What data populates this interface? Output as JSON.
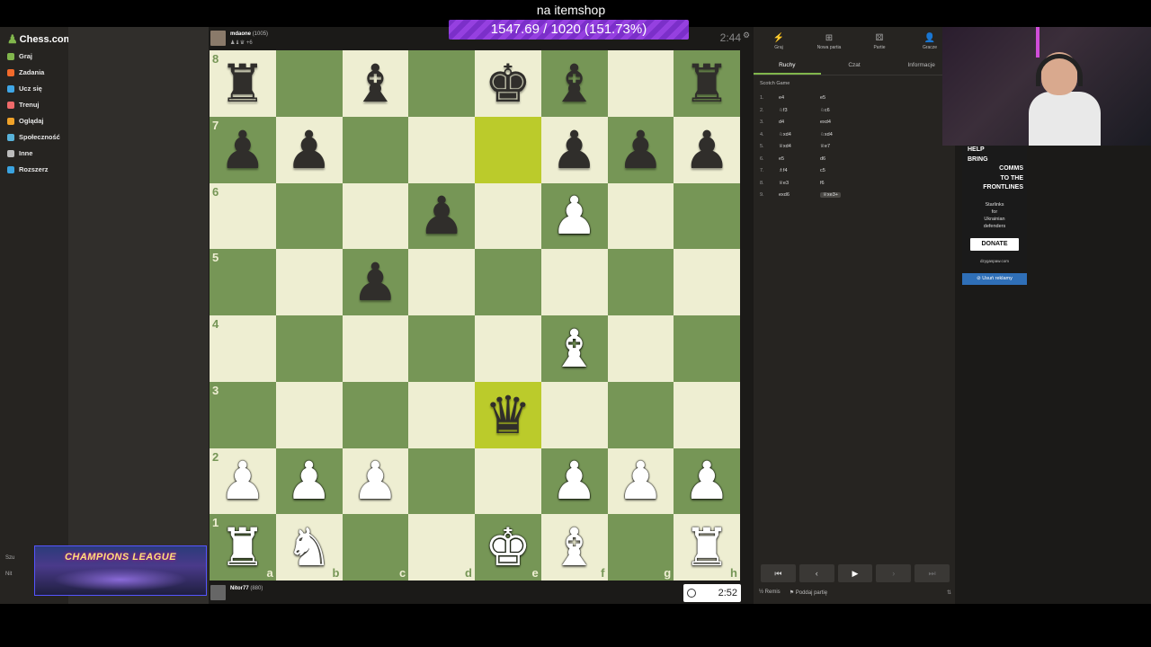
{
  "stream": {
    "itemshop_text": "na itemshop",
    "goal_text": "1547.69 / 1020 (151.73%)"
  },
  "logo": {
    "text": "Chess.com"
  },
  "sidebar": {
    "items": [
      {
        "label": "Graj",
        "color": "#81b64c"
      },
      {
        "label": "Zadania",
        "color": "#f26a2b"
      },
      {
        "label": "Ucz się",
        "color": "#3fa6e6"
      },
      {
        "label": "Trenuj",
        "color": "#ef6a6a"
      },
      {
        "label": "Oglądaj",
        "color": "#f0a229"
      },
      {
        "label": "Społeczność",
        "color": "#58b2d9"
      },
      {
        "label": "Inne",
        "color": "#bbbbbb"
      },
      {
        "label": "Rozszerz",
        "color": "#3aa3e0"
      }
    ],
    "bottom": [
      "Szu",
      "Nit"
    ]
  },
  "players": {
    "top": {
      "name": "mdaone",
      "rating": "(1005)",
      "captures": "+6",
      "clock": "2:44"
    },
    "bottom": {
      "name": "Nitor77",
      "rating": "(880)",
      "clock": "2:52"
    }
  },
  "board": {
    "light": "#eeeed2",
    "dark": "#769656",
    "highlight": "#bbcb2b",
    "ranks": [
      "8",
      "7",
      "6",
      "5",
      "4",
      "3",
      "2",
      "1"
    ],
    "files": [
      "a",
      "b",
      "c",
      "d",
      "e",
      "f",
      "g",
      "h"
    ],
    "highlighted": [
      "e7",
      "e3"
    ],
    "pieces": {
      "a8": "bR",
      "c8": "bB",
      "e8": "bK",
      "f8": "bB",
      "h8": "bR",
      "a7": "bP",
      "b7": "bP",
      "f7": "bP",
      "g7": "bP",
      "h7": "bP",
      "d6": "bP",
      "f6": "wP",
      "c5": "bP",
      "f4": "wB",
      "e3": "bQ",
      "a2": "wP",
      "b2": "wP",
      "c2": "wP",
      "f2": "wP",
      "g2": "wP",
      "h2": "wP",
      "a1": "wR",
      "b1": "wN",
      "e1": "wK",
      "f1": "wB",
      "h1": "wR"
    }
  },
  "panel": {
    "tabs": [
      {
        "label": "Graj",
        "icon": "bolt-icon"
      },
      {
        "label": "Nowa partia",
        "icon": "plus-icon"
      },
      {
        "label": "Partie",
        "icon": "dice-icon"
      },
      {
        "label": "Gracze",
        "icon": "users-icon"
      }
    ],
    "subtabs": [
      "Ruchy",
      "Czat",
      "Informacje"
    ],
    "opening": "Scotch Game",
    "moves": [
      {
        "n": "1.",
        "w": "e4",
        "b": "e5"
      },
      {
        "n": "2.",
        "w": "♘f3",
        "b": "♘c6"
      },
      {
        "n": "3.",
        "w": "d4",
        "b": "exd4"
      },
      {
        "n": "4.",
        "w": "♘xd4",
        "b": "♘xd4"
      },
      {
        "n": "5.",
        "w": "♕xd4",
        "b": "♕e7"
      },
      {
        "n": "6.",
        "w": "e5",
        "b": "d6"
      },
      {
        "n": "7.",
        "w": "♗f4",
        "b": "c5"
      },
      {
        "n": "8.",
        "w": "♕e3",
        "b": "f6"
      },
      {
        "n": "9.",
        "w": "exd6",
        "b": "♕xe3+"
      }
    ],
    "controls": [
      "⏮",
      "‹",
      "▶",
      "›",
      "⏭"
    ],
    "draw_label": "Remis",
    "resign_label": "Poddaj partię"
  },
  "ad": {
    "headline": [
      "HELP",
      "BRING",
      "COMMS",
      "TO THE",
      "FRONTLINES"
    ],
    "sub": [
      "Starlinks",
      "for",
      "Ukrainian",
      "defenders"
    ],
    "donate": "DONATE",
    "site": "dzygaspaw.com",
    "remove": "Usuń reklamy"
  },
  "overlay": {
    "champions": "CHAMPIONS LEAGUE"
  }
}
